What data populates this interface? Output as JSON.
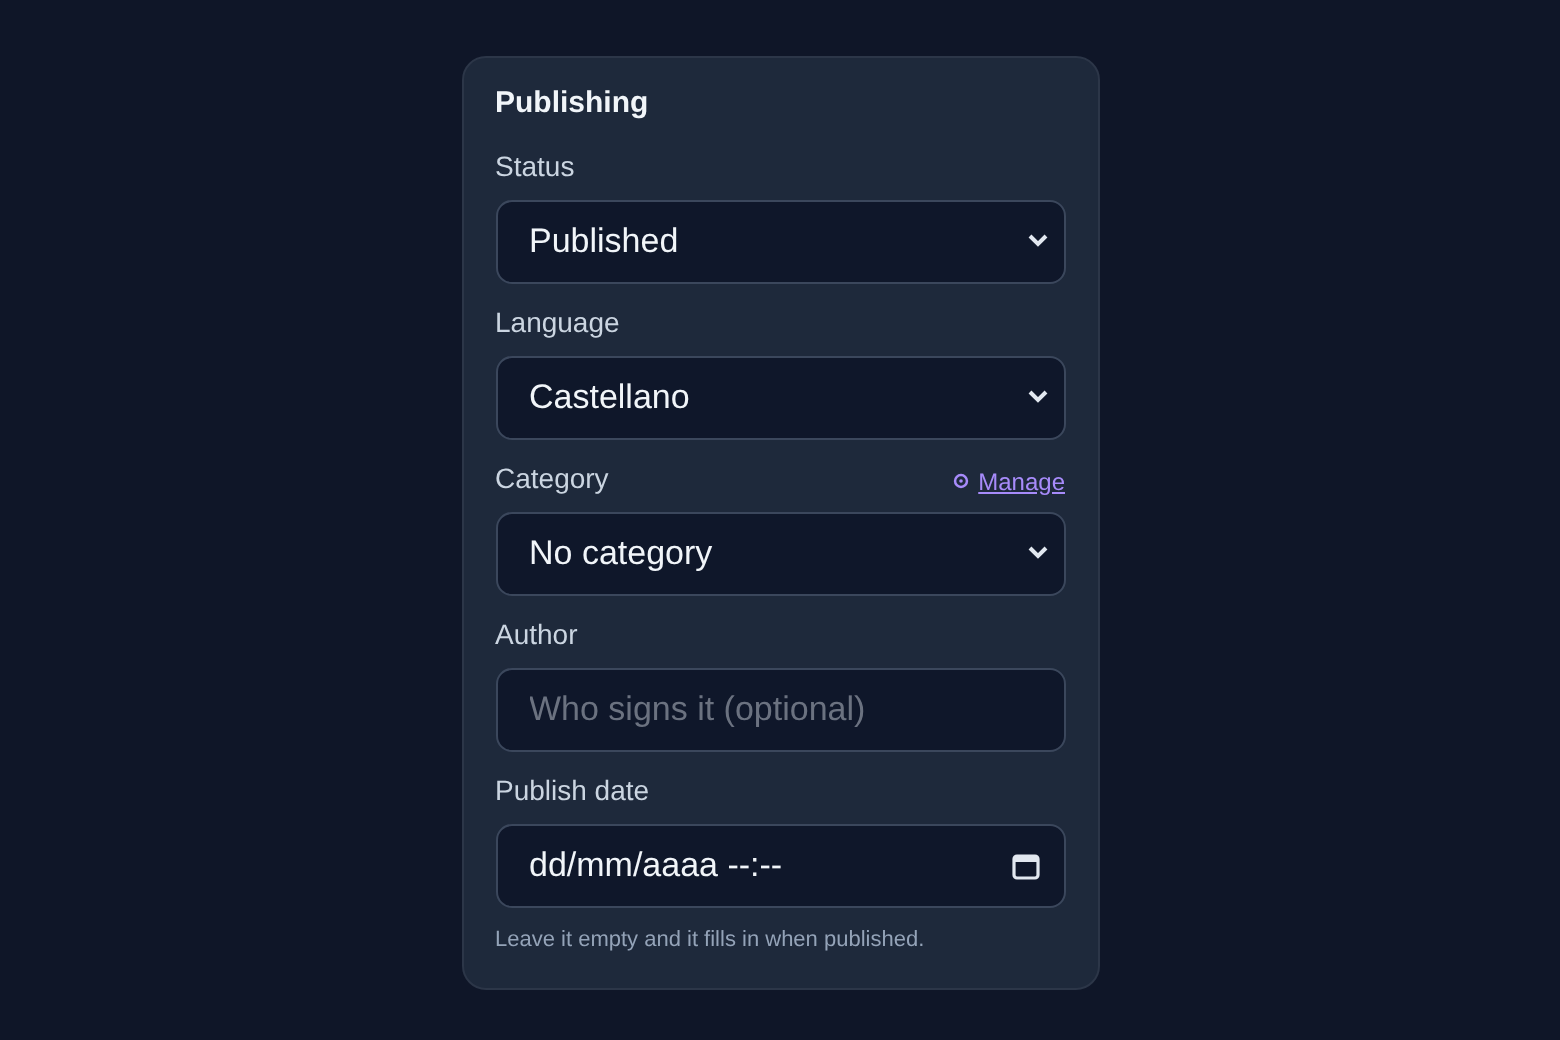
{
  "panel": {
    "title": "Publishing",
    "fields": [
      {
        "kind": "select",
        "label": "Status",
        "value": "Published"
      },
      {
        "kind": "select",
        "label": "Language",
        "value": "Castellano"
      },
      {
        "kind": "select",
        "label": "Category",
        "value": "No category",
        "link": "Manage"
      },
      {
        "kind": "text",
        "label": "Author",
        "placeholder": "Who signs it (optional)"
      },
      {
        "kind": "datetime",
        "label": "Publish date",
        "value": "dd/mm/aaaa --:--",
        "hint": "Leave it empty and it fills in when published."
      }
    ]
  }
}
